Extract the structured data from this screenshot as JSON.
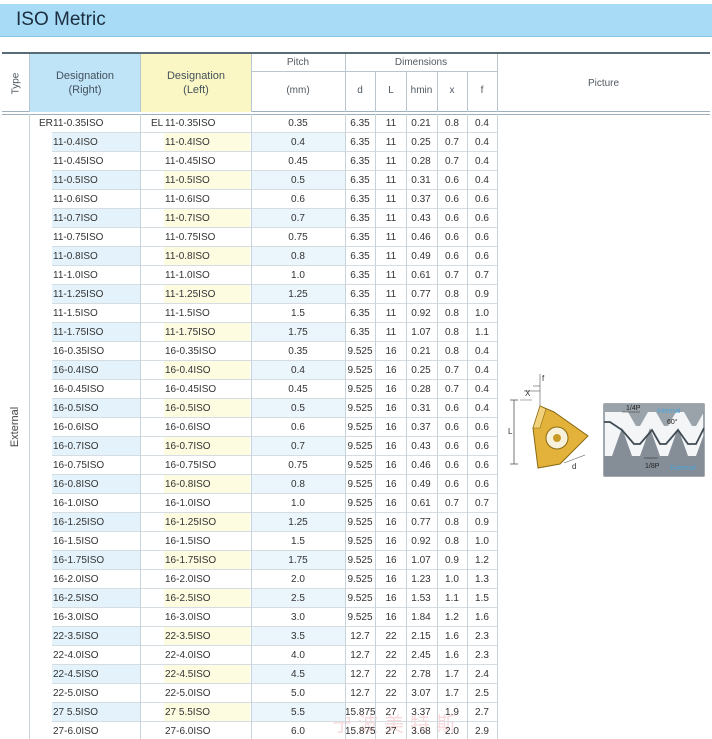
{
  "title": "ISO Metric",
  "header": {
    "type": "Type",
    "designation_right": [
      "Designation",
      "(Right)"
    ],
    "designation_left": [
      "Designation",
      "(Left)"
    ],
    "pitch": "Pitch",
    "pitch_unit": "(mm)",
    "dimensions": "Dimensions",
    "col_d": "d",
    "col_L": "L",
    "col_hmin": "hmin",
    "col_x": "x",
    "col_f": "f",
    "picture": "Picture"
  },
  "type_value": "External",
  "right_prefix": "ER",
  "left_prefix": "EL",
  "figure": {
    "label_x": "X",
    "label_f": "f",
    "label_L": "L",
    "label_d": "d",
    "label_quarter_p": "1/4P",
    "label_internal": "Internal",
    "label_angle": "60°",
    "label_eighth_p": "1/8P",
    "label_external": "External"
  },
  "watermark": "宁波美特斯",
  "colors": {
    "title_bar": "#a8dcf6",
    "right_highlight": "#e4f3fb",
    "left_highlight": "#fdfbe0",
    "pitch_highlight": "#eaf5fc"
  },
  "rows": [
    {
      "r": "11-0.35ISO",
      "l": "11-0.35ISO",
      "p": "0.35",
      "d": "6.35",
      "L": "11",
      "h": "0.21",
      "x": "0.8",
      "f": "0.4"
    },
    {
      "r": "11-0.4ISO",
      "l": "11-0.4ISO",
      "p": "0.4",
      "d": "6.35",
      "L": "11",
      "h": "0.25",
      "x": "0.7",
      "f": "0.4"
    },
    {
      "r": "11-0.45ISO",
      "l": "11-0.45ISO",
      "p": "0.45",
      "d": "6.35",
      "L": "11",
      "h": "0.28",
      "x": "0.7",
      "f": "0.4"
    },
    {
      "r": "11-0.5ISO",
      "l": "11-0.5ISO",
      "p": "0.5",
      "d": "6.35",
      "L": "11",
      "h": "0.31",
      "x": "0.6",
      "f": "0.4"
    },
    {
      "r": "11-0.6ISO",
      "l": "11-0.6ISO",
      "p": "0.6",
      "d": "6.35",
      "L": "11",
      "h": "0.37",
      "x": "0.6",
      "f": "0.6"
    },
    {
      "r": "11-0.7ISO",
      "l": "11-0.7ISO",
      "p": "0.7",
      "d": "6.35",
      "L": "11",
      "h": "0.43",
      "x": "0.6",
      "f": "0.6"
    },
    {
      "r": "11-0.75ISO",
      "l": "11-0.75ISO",
      "p": "0.75",
      "d": "6.35",
      "L": "11",
      "h": "0.46",
      "x": "0.6",
      "f": "0.6"
    },
    {
      "r": "11-0.8ISO",
      "l": "11-0.8ISO",
      "p": "0.8",
      "d": "6.35",
      "L": "11",
      "h": "0.49",
      "x": "0.6",
      "f": "0.6"
    },
    {
      "r": "11-1.0ISO",
      "l": "11-1.0ISO",
      "p": "1.0",
      "d": "6.35",
      "L": "11",
      "h": "0.61",
      "x": "0.7",
      "f": "0.7"
    },
    {
      "r": "11-1.25ISO",
      "l": "11-1.25ISO",
      "p": "1.25",
      "d": "6.35",
      "L": "11",
      "h": "0.77",
      "x": "0.8",
      "f": "0.9"
    },
    {
      "r": "11-1.5ISO",
      "l": "11-1.5ISO",
      "p": "1.5",
      "d": "6.35",
      "L": "11",
      "h": "0.92",
      "x": "0.8",
      "f": "1.0"
    },
    {
      "r": "11-1.75ISO",
      "l": "11-1.75ISO",
      "p": "1.75",
      "d": "6.35",
      "L": "11",
      "h": "1.07",
      "x": "0.8",
      "f": "1.1"
    },
    {
      "r": "16-0.35ISO",
      "l": "16-0.35ISO",
      "p": "0.35",
      "d": "9.525",
      "L": "16",
      "h": "0.21",
      "x": "0.8",
      "f": "0.4"
    },
    {
      "r": "16-0.4ISO",
      "l": "16-0.4ISO",
      "p": "0.4",
      "d": "9.525",
      "L": "16",
      "h": "0.25",
      "x": "0.7",
      "f": "0.4"
    },
    {
      "r": "16-0.45ISO",
      "l": "16-0.45ISO",
      "p": "0.45",
      "d": "9.525",
      "L": "16",
      "h": "0.28",
      "x": "0.7",
      "f": "0.4"
    },
    {
      "r": "16-0.5ISO",
      "l": "16-0.5ISO",
      "p": "0.5",
      "d": "9.525",
      "L": "16",
      "h": "0.31",
      "x": "0.6",
      "f": "0.4"
    },
    {
      "r": "16-0.6ISO",
      "l": "16-0.6ISO",
      "p": "0.6",
      "d": "9.525",
      "L": "16",
      "h": "0.37",
      "x": "0.6",
      "f": "0.6"
    },
    {
      "r": "16-0.7ISO",
      "l": "16-0.7ISO",
      "p": "0.7",
      "d": "9.525",
      "L": "16",
      "h": "0.43",
      "x": "0.6",
      "f": "0.6"
    },
    {
      "r": "16-0.75ISO",
      "l": "16-0.75ISO",
      "p": "0.75",
      "d": "9.525",
      "L": "16",
      "h": "0.46",
      "x": "0.6",
      "f": "0.6"
    },
    {
      "r": "16-0.8ISO",
      "l": "16-0.8ISO",
      "p": "0.8",
      "d": "9.525",
      "L": "16",
      "h": "0.49",
      "x": "0.6",
      "f": "0.6"
    },
    {
      "r": "16-1.0ISO",
      "l": "16-1.0ISO",
      "p": "1.0",
      "d": "9.525",
      "L": "16",
      "h": "0.61",
      "x": "0.7",
      "f": "0.7"
    },
    {
      "r": "16-1.25ISO",
      "l": "16-1.25ISO",
      "p": "1.25",
      "d": "9.525",
      "L": "16",
      "h": "0.77",
      "x": "0.8",
      "f": "0.9"
    },
    {
      "r": "16-1.5ISO",
      "l": "16-1.5ISO",
      "p": "1.5",
      "d": "9.525",
      "L": "16",
      "h": "0.92",
      "x": "0.8",
      "f": "1.0"
    },
    {
      "r": "16-1.75ISO",
      "l": "16-1.75ISO",
      "p": "1.75",
      "d": "9.525",
      "L": "16",
      "h": "1.07",
      "x": "0.9",
      "f": "1.2"
    },
    {
      "r": "16-2.0ISO",
      "l": "16-2.0ISO",
      "p": "2.0",
      "d": "9.525",
      "L": "16",
      "h": "1.23",
      "x": "1.0",
      "f": "1.3"
    },
    {
      "r": "16-2.5ISO",
      "l": "16-2.5ISO",
      "p": "2.5",
      "d": "9.525",
      "L": "16",
      "h": "1.53",
      "x": "1.1",
      "f": "1.5"
    },
    {
      "r": "16-3.0ISO",
      "l": "16-3.0ISO",
      "p": "3.0",
      "d": "9.525",
      "L": "16",
      "h": "1.84",
      "x": "1.2",
      "f": "1.6"
    },
    {
      "r": "22-3.5ISO",
      "l": "22-3.5ISO",
      "p": "3.5",
      "d": "12.7",
      "L": "22",
      "h": "2.15",
      "x": "1.6",
      "f": "2.3"
    },
    {
      "r": "22-4.0ISO",
      "l": "22-4.0ISO",
      "p": "4.0",
      "d": "12.7",
      "L": "22",
      "h": "2.45",
      "x": "1.6",
      "f": "2.3"
    },
    {
      "r": "22-4.5ISO",
      "l": "22-4.5ISO",
      "p": "4.5",
      "d": "12.7",
      "L": "22",
      "h": "2.78",
      "x": "1.7",
      "f": "2.4"
    },
    {
      "r": "22-5.0ISO",
      "l": "22-5.0ISO",
      "p": "5.0",
      "d": "12.7",
      "L": "22",
      "h": "3.07",
      "x": "1.7",
      "f": "2.5"
    },
    {
      "r": "27 5.5ISO",
      "l": "27 5.5ISO",
      "p": "5.5",
      "d": "15.875",
      "L": "27",
      "h": "3.37",
      "x": "1.9",
      "f": "2.7"
    },
    {
      "r": "27-6.0ISO",
      "l": "27-6.0ISO",
      "p": "6.0",
      "d": "15.875",
      "L": "27",
      "h": "3.68",
      "x": "2.0",
      "f": "2.9"
    }
  ]
}
